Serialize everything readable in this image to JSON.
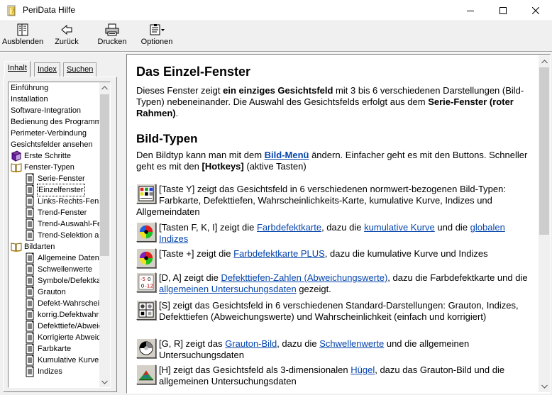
{
  "window": {
    "title": "PeriData Hilfe"
  },
  "toolbar": {
    "hide_label": "Ausblenden",
    "back_label": "Zurück",
    "print_label": "Drucken",
    "options_label": "Optionen"
  },
  "tabs": [
    {
      "label": "Inhalt"
    },
    {
      "label": "Index"
    },
    {
      "label": "Suchen"
    }
  ],
  "tree": [
    {
      "label": "Einführung",
      "icon": "none",
      "level": 0
    },
    {
      "label": "Installation",
      "icon": "none",
      "level": 0
    },
    {
      "label": "Software-Integration",
      "icon": "none",
      "level": 0
    },
    {
      "label": "Bedienung des Programms",
      "icon": "none",
      "level": 0
    },
    {
      "label": "Perimeter-Verbindung",
      "icon": "none",
      "level": 0
    },
    {
      "label": "Gesichtsfelder ansehen",
      "icon": "none",
      "level": 0
    },
    {
      "label": "Erste Schritte",
      "icon": "book-closed",
      "level": 0
    },
    {
      "label": "Fenster-Typen",
      "icon": "book-open",
      "level": 0
    },
    {
      "label": "Serie-Fenster",
      "icon": "page",
      "level": 1
    },
    {
      "label": "Einzelfenster",
      "icon": "page",
      "level": 1,
      "selected": true
    },
    {
      "label": "Links-Rechts-Fenster",
      "icon": "page",
      "level": 1
    },
    {
      "label": "Trend-Fenster",
      "icon": "page",
      "level": 1
    },
    {
      "label": "Trend-Auswahl-Fenster",
      "icon": "page",
      "level": 1
    },
    {
      "label": "Trend-Selektion auswählen",
      "icon": "page",
      "level": 1
    },
    {
      "label": "Bildarten",
      "icon": "book-open",
      "level": 0
    },
    {
      "label": "Allgemeine Daten",
      "icon": "page",
      "level": 1
    },
    {
      "label": "Schwellenwerte",
      "icon": "page",
      "level": 1
    },
    {
      "label": "Symbole/Defektkarte",
      "icon": "page",
      "level": 1
    },
    {
      "label": "Grauton",
      "icon": "page",
      "level": 1
    },
    {
      "label": "Defekt-Wahrscheinlichkeit",
      "icon": "page",
      "level": 1
    },
    {
      "label": "korrig.Defektwahrscheinlichkeit",
      "icon": "page",
      "level": 1
    },
    {
      "label": "Defekttiefe/Abweichung",
      "icon": "page",
      "level": 1
    },
    {
      "label": "Korrigierte Abweichung",
      "icon": "page",
      "level": 1
    },
    {
      "label": "Farbkarte",
      "icon": "page",
      "level": 1
    },
    {
      "label": "Kumulative Kurve",
      "icon": "page",
      "level": 1
    },
    {
      "label": "Indizes",
      "icon": "page",
      "level": 1
    }
  ],
  "content": {
    "title": "Das Einzel-Fenster",
    "intro": {
      "t1": "Dieses Fenster zeigt ",
      "b1": "ein einziges Gesichtsfeld",
      "t2": " mit 3 bis 6 verschiedenen Darstellungen (Bild-Typen) nebeneinander. Die Auswahl des Gesichtsfelds erfolgt aus dem ",
      "b2": "Serie-Fenster (roter Rahmen)",
      "t3": "."
    },
    "section_title": "Bild-Typen",
    "section_intro": {
      "t1": "Den Bildtyp kann man mit dem ",
      "link1": "Bild-Menü",
      "t2": " ändern. Einfacher geht es mit den Buttons. Schneller geht es mit den ",
      "b1": "[Hotkeys]",
      "t3": " (aktive Tasten)"
    },
    "entries": [
      {
        "icon": "grid-icon",
        "parts": [
          {
            "t": "[Taste Y]  zeigt das Gesichtsfeld in 6 verschiedenen normwert-bezogenen Bild-Typen: Farbkarte, Defekttiefen, Wahrscheinlichkeits-Karte, kumulative Kurve, Indizes und Allgemeindaten"
          }
        ]
      },
      {
        "icon": "color-wheel-icon",
        "parts": [
          {
            "t": "[Tasten F, K, I]  zeigt die "
          },
          {
            "l": "Farbdefektkarte"
          },
          {
            "t": ", dazu die "
          },
          {
            "l": "kumulative Kurve"
          },
          {
            "t": " und die "
          },
          {
            "l": "globalen Indizes"
          }
        ]
      },
      {
        "icon": "color-wheel-plus-icon",
        "parts": [
          {
            "t": "[Taste +]  zeigt die "
          },
          {
            "l": "Farbdefektkarte PLUS"
          },
          {
            "t": ", dazu die kumulative Kurve und Indizes"
          }
        ]
      },
      {
        "icon": "numbers-icon",
        "parts": [
          {
            "t": "[D, A]  zeigt die "
          },
          {
            "l": "Defekttiefen-Zahlen (Abweichungswerte)"
          },
          {
            "t": ", dazu die Farbdefektkarte und die "
          },
          {
            "l": "allgemeinen Untersuchungsdaten"
          },
          {
            "t": " gezeigt."
          }
        ]
      },
      {
        "icon": "standard-grid-icon",
        "parts": [
          {
            "t": "[S]  zeigt das Gesichtsfeld in 6 verschiedenen Standard-Darstellungen: Grauton, Indizes, Defekttiefen (Abweichungswerte) und Wahrscheinlichkeit (einfach und korrigiert)"
          }
        ]
      },
      {
        "icon": "grayscale-icon",
        "parts": [
          {
            "t": "[G, R]  zeigt das "
          },
          {
            "l": "Grauton-Bild"
          },
          {
            "t": ", dazu die "
          },
          {
            "l": "Schwellenwerte"
          },
          {
            "t": " und die allgemeinen Untersuchungsdaten"
          }
        ]
      },
      {
        "icon": "hill-icon",
        "parts": [
          {
            "t": "[H]  zeigt das Gesichtsfeld als 3-dimensionalen "
          },
          {
            "l": "Hügel"
          },
          {
            "t": ", dazu das Grauton-Bild und die allgemeinen Untersuchungsdaten"
          }
        ]
      }
    ]
  }
}
